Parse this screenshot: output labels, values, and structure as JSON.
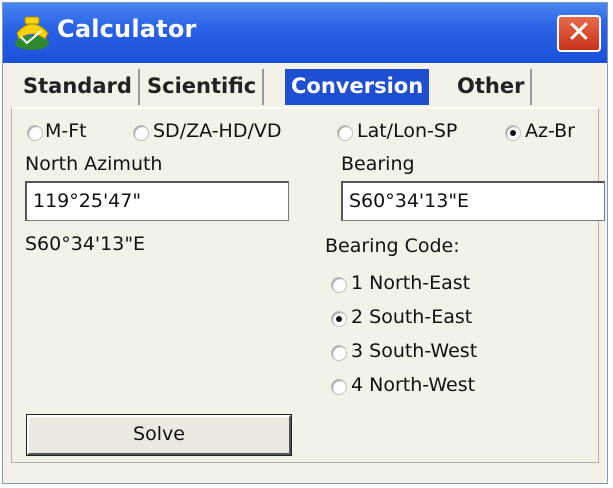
{
  "window": {
    "title": "Calculator",
    "close_label": "✕"
  },
  "icons": {
    "app": "calculator-app-icon",
    "close": "close-icon"
  },
  "colors": {
    "titlebar": "#2a63e6",
    "active_tab": "#1e4fd0",
    "close": "#c8331a",
    "background": "#f2f2e8"
  },
  "tabs": [
    {
      "label": "Standard"
    },
    {
      "label": "Scientific"
    },
    {
      "label": "Conversion",
      "active": true
    },
    {
      "label": "Other"
    }
  ],
  "modes": [
    {
      "label": "M-Ft",
      "checked": false
    },
    {
      "label": "SD/ZA-HD/VD",
      "checked": false
    },
    {
      "label": "Lat/Lon-SP",
      "checked": false
    },
    {
      "label": "Az-Br",
      "checked": true
    }
  ],
  "azimuth": {
    "label": "North Azimuth",
    "value": "119°25'47\"",
    "result": "S60°34'13\"E"
  },
  "bearing": {
    "label": "Bearing",
    "value": "S60°34'13\"E"
  },
  "bearing_code": {
    "label": "Bearing Code:",
    "options": [
      {
        "label": "1 North-East",
        "checked": false
      },
      {
        "label": "2 South-East",
        "checked": true
      },
      {
        "label": "3 South-West",
        "checked": false
      },
      {
        "label": "4 North-West",
        "checked": false
      }
    ]
  },
  "solve_label": "Solve"
}
